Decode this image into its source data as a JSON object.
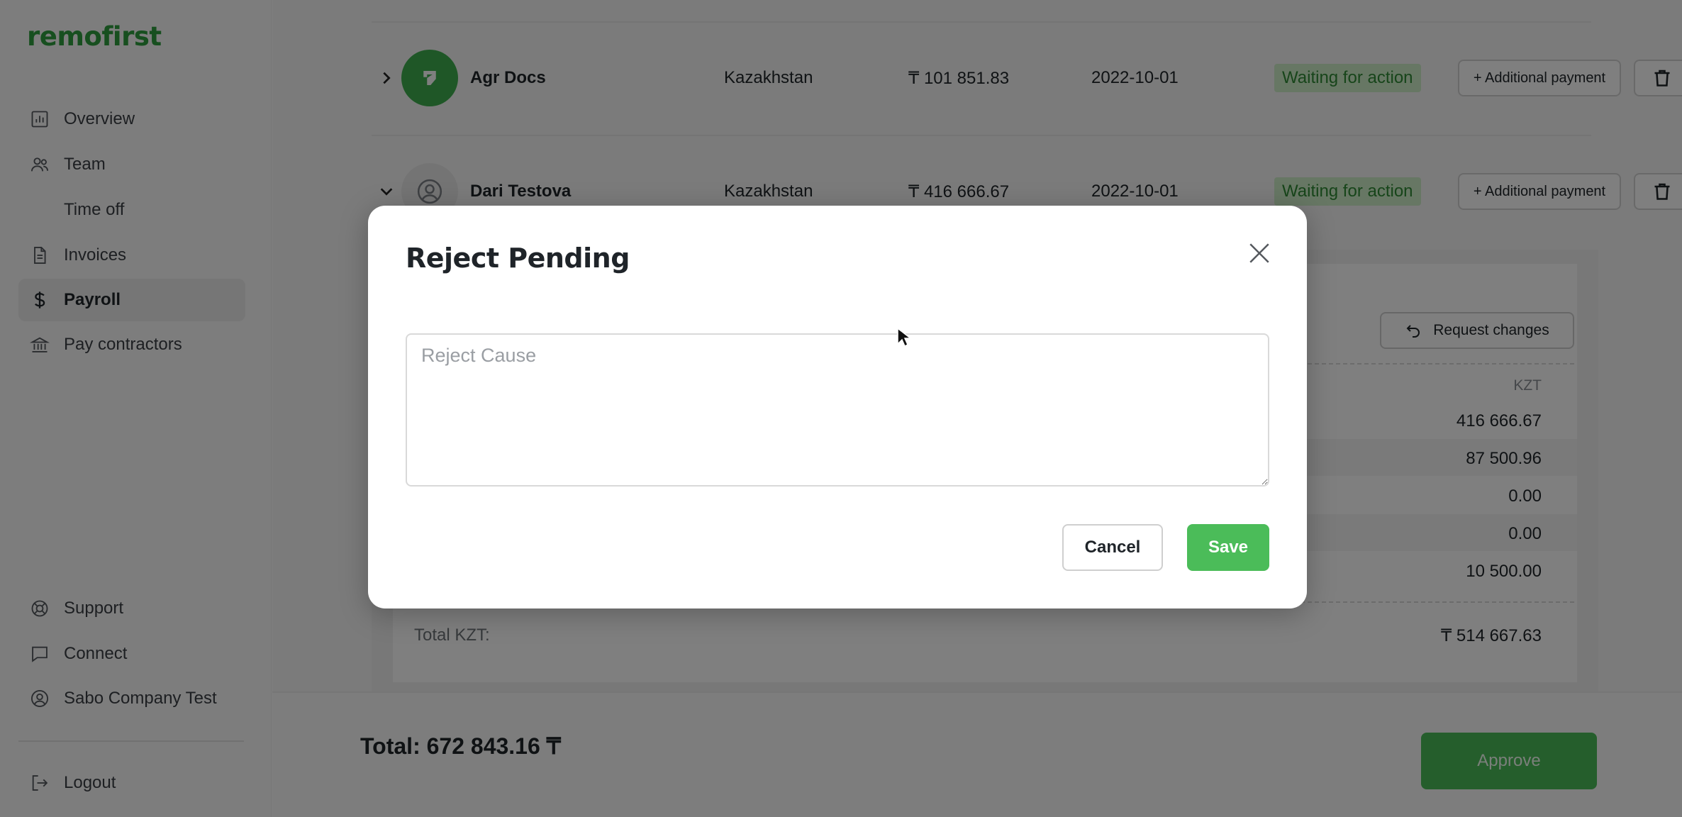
{
  "brand": {
    "logo_text": "remofirst",
    "accent": "#4bbc59"
  },
  "sidebar": {
    "items": [
      {
        "label": "Overview",
        "icon": "chart-icon"
      },
      {
        "label": "Team",
        "icon": "users-icon"
      },
      {
        "label": "Time off",
        "icon": ""
      },
      {
        "label": "Invoices",
        "icon": "document-icon"
      },
      {
        "label": "Payroll",
        "icon": "dollar-icon",
        "active": true
      },
      {
        "label": "Pay contractors",
        "icon": "bank-icon"
      }
    ],
    "bottom_items": [
      {
        "label": "Support",
        "icon": "lifebuoy-icon"
      },
      {
        "label": "Connect",
        "icon": "chat-icon"
      },
      {
        "label": "Sabo Company Test",
        "icon": "user-circle-icon"
      },
      {
        "label": "Logout",
        "icon": "logout-icon"
      }
    ]
  },
  "payroll": {
    "rows": [
      {
        "name": "Agr Docs",
        "country": "Kazakhstan",
        "amount": "₸ 101 851.83",
        "date": "2022-10-01",
        "status": "Waiting for action",
        "add_payment": "+ Additional payment",
        "expanded": false
      },
      {
        "name": "Dari Testova",
        "country": "Kazakhstan",
        "amount": "₸ 416 666.67",
        "date": "2022-10-01",
        "status": "Waiting for action",
        "add_payment": "+ Additional payment",
        "expanded": true
      }
    ],
    "detail": {
      "request_changes": "Request changes",
      "currency": "KZT",
      "values": [
        "416 666.67",
        "87 500.96",
        "0.00",
        "0.00",
        "10 500.00"
      ],
      "total_label": "Total KZT:",
      "total_value": "₸ 514 667.63"
    },
    "footer": {
      "grand_total": "Total: 672 843.16 ₸",
      "approve_label": "Approve"
    }
  },
  "modal": {
    "title": "Reject Pending",
    "reason_placeholder": "Reject Cause",
    "reason_value": "",
    "cancel_label": "Cancel",
    "save_label": "Save"
  }
}
